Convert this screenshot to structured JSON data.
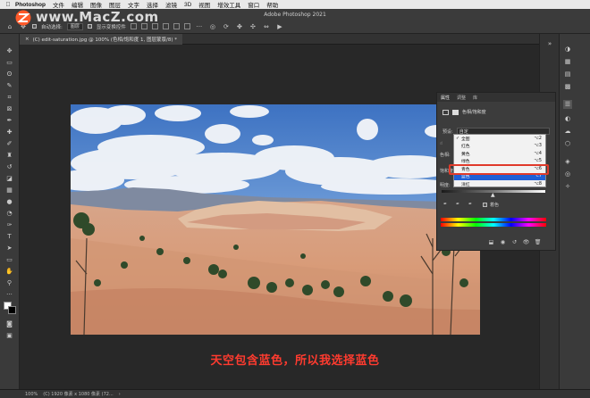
{
  "menubar": {
    "app_name": "Photoshop",
    "items": [
      "文件",
      "编辑",
      "图像",
      "图层",
      "文字",
      "选择",
      "滤镜",
      "3D",
      "视图",
      "增效工具",
      "窗口",
      "帮助"
    ]
  },
  "watermark": {
    "text": "www.MacZ.com"
  },
  "titlebar": {
    "title": "Adobe Photoshop 2021"
  },
  "options": {
    "auto_select_label": "自动选择:",
    "auto_select_value": "图层",
    "show_transform_label": "显示变换控件"
  },
  "document_tab": {
    "label": "(C) edit-saturation.jpg @ 100% (色相/饱和度 1, 图层蒙版/8) *",
    "close_glyph": "×"
  },
  "properties_panel": {
    "tabs": [
      "属性",
      "调整",
      "库"
    ],
    "adjustment_title": "色相/饱和度",
    "preset_label": "预设:",
    "preset_value": "自定",
    "side_labels": [
      "色相:",
      "饱和度:",
      "明度:"
    ],
    "colorize_label": "着色"
  },
  "channel_dropdown": {
    "items": [
      {
        "label": "全图",
        "shortcut": "⌥2",
        "checked": true,
        "selected": false
      },
      {
        "label": "红色",
        "shortcut": "⌥3",
        "checked": false,
        "selected": false
      },
      {
        "label": "黄色",
        "shortcut": "⌥4",
        "checked": false,
        "selected": false
      },
      {
        "label": "绿色",
        "shortcut": "⌥5",
        "checked": false,
        "selected": false
      },
      {
        "label": "青色",
        "shortcut": "⌥6",
        "checked": false,
        "selected": false
      },
      {
        "label": "蓝色",
        "shortcut": "⌥7",
        "checked": false,
        "selected": true
      },
      {
        "label": "洋红",
        "shortcut": "⌥8",
        "checked": false,
        "selected": false
      }
    ]
  },
  "subtitle": {
    "text": "天空包含蓝色，所以我选择蓝色"
  },
  "statusbar": {
    "zoom": "100%",
    "doc_info": "(C) 1920 像素 x 1080 像素 (72..."
  },
  "colors": {
    "subtitle_red": "#ff3b2f",
    "highlight_blue": "#1f5fd6",
    "annotation_red": "#e03a2a"
  }
}
